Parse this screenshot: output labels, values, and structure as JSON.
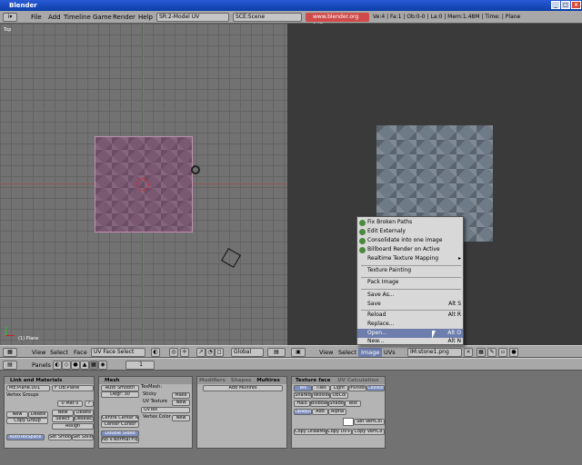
{
  "window": {
    "title": "Blender"
  },
  "menubar": {
    "items": [
      "File",
      "Add",
      "Timeline",
      "Game",
      "Render",
      "Help"
    ],
    "screen": "SR:2-Model UV",
    "scene": "SCE:Scene",
    "url": "www.blender.org 245",
    "stats": "Ve:4 | Fa:1 | Ob:0-0 | La:0 | Mem:1.48M | Time: | Plane"
  },
  "view3d": {
    "label": "Top",
    "object_label": "(1) Plane",
    "header": {
      "view": "View",
      "select": "Select",
      "face": "Face",
      "mode": "UV Face Select",
      "orientation": "Global"
    }
  },
  "imageview": {
    "header": {
      "view": "View",
      "select": "Select",
      "image": "Image",
      "uvs": "UVs",
      "image_name": "IM:stone1.png"
    }
  },
  "popup": {
    "items": [
      {
        "label": "Fix Broken Paths",
        "icon": true
      },
      {
        "label": "Edit Externaly",
        "icon": true
      },
      {
        "label": "Consolidate into one image",
        "icon": true
      },
      {
        "label": "Billboard Render on Active",
        "icon": true
      },
      {
        "label": "Realtime Texture Mapping",
        "arrow": "▸"
      },
      {
        "label": "Texture Painting"
      },
      {
        "label": "Pack Image"
      },
      {
        "label": "Save As..."
      },
      {
        "label": "Save",
        "shortcut": "Alt S"
      },
      {
        "label": "Reload",
        "shortcut": "Alt R"
      },
      {
        "label": "Replace..."
      },
      {
        "label": "Open...",
        "shortcut": "Alt O",
        "highlight": true
      },
      {
        "label": "New...",
        "shortcut": "Alt N"
      }
    ]
  },
  "buttons": {
    "header": {
      "panels": "Panels",
      "frame": "1"
    },
    "link": {
      "title": "Link and Materials",
      "me": "ME:Plane.001",
      "ob": "F  OB:Plane",
      "vgroups": "Vertex Groups",
      "mat": "0 Mat 0",
      "q": "?",
      "new": "New",
      "delete": "Delete",
      "copy_group": "Copy Group",
      "new2": "New",
      "delete2": "Delete",
      "select": "Select",
      "deselect": "Deselect",
      "assign": "Assign",
      "autotex": "AutoTexSpace",
      "set_smooth": "Set Smoo",
      "set_solid": "Set Solid"
    },
    "mesh": {
      "title": "Mesh",
      "auto_smooth": "Auto Smooth",
      "degr": "Degr: 30",
      "texmesh": "TexMesh:",
      "sticky": "Sticky",
      "make": "Make",
      "uvtex": "UV Texture",
      "new": "New",
      "uvtex_name": "UVTex",
      "vcol": "Vertex Color",
      "new2": "New",
      "center_new": "Centre  Center New",
      "center_cursor": "Center Cursor",
      "double_sided": "Double Sided",
      "no_vnormal": "No V.Normal Flip"
    },
    "modifiers": {
      "tab1": "Modifiers",
      "tab2": "Shapes",
      "tab3": "Multires",
      "add": "Add Multires"
    },
    "texface": {
      "tab1": "Texture face",
      "tab2": "UV Calculation",
      "row1": [
        "Tex",
        "Tiles",
        "Light",
        "Invisibl",
        "Collision"
      ],
      "row2": [
        "Shared",
        "Twoside",
        "ObCol"
      ],
      "row3": [
        "Halo",
        "Billboar",
        "Shado",
        "Text"
      ],
      "row4": [
        "Opaque",
        "Add",
        "Alpha"
      ],
      "set_vertcol": "Set VertCol",
      "copy_drawmode": "Copy DrawMo",
      "copy_uv": "Copy UV+",
      "copy_vertco": "Copy VertCo"
    }
  },
  "colors": {
    "title_blue": "#0b3ea8",
    "highlight": "#6d7dac",
    "url_red": "#d04a4a"
  }
}
